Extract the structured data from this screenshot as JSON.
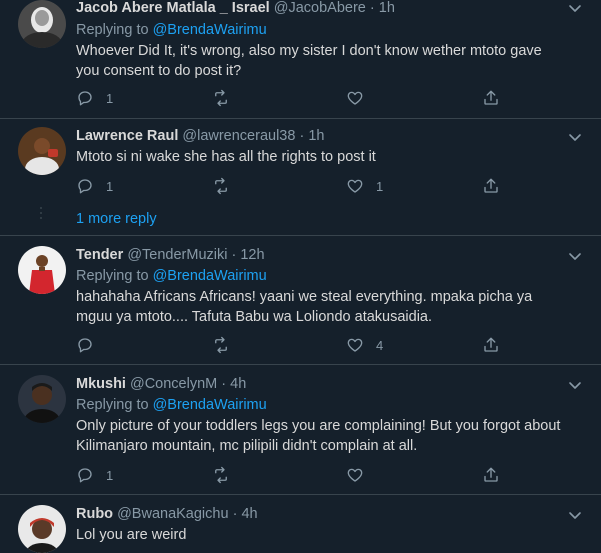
{
  "colors": {
    "background": "#15202b",
    "text": "#d9d9d9",
    "muted": "#8899a6",
    "accent": "#1da1f2",
    "separator": "#38444d"
  },
  "tweets": [
    {
      "name": "Jacob Abere Matlala _ Israel",
      "handle": "@JacobAbere",
      "dot": "·",
      "time": "1h",
      "replying_prefix": "Replying to ",
      "replying_to": "@BrendaWairimu",
      "text_lines": [
        "Whoever Did It, it's wrong, also my sister I don't know wether mtoto gave",
        "you consent to do post it?"
      ],
      "reply_count": "1",
      "retweet_count": "",
      "like_count": "",
      "icons": {
        "reply": "reply-icon",
        "retweet": "retweet-icon",
        "like": "heart-icon",
        "share": "share-icon",
        "menu": "chevron-down-icon"
      }
    },
    {
      "name": "Lawrence Raul",
      "handle": "@lawrenceraul38",
      "dot": "·",
      "time": "1h",
      "text_lines": [
        "Mtoto si ni wake she has all the rights to post it"
      ],
      "reply_count": "1",
      "retweet_count": "",
      "like_count": "1"
    },
    {
      "name": "Tender",
      "handle": "@TenderMuziki",
      "dot": "·",
      "time": "12h",
      "replying_prefix": "Replying to ",
      "replying_to": "@BrendaWairimu",
      "text_lines": [
        "hahahaha Africans Africans! yaani we steal everything. mpaka picha ya",
        "mguu ya mtoto.... Tafuta Babu wa Loliondo atakusaidia."
      ],
      "reply_count": "",
      "retweet_count": "",
      "like_count": "4"
    },
    {
      "name": "Mkushi",
      "handle": "@ConcelynM",
      "dot": "·",
      "time": "4h",
      "replying_prefix": "Replying to ",
      "replying_to": "@BrendaWairimu",
      "text_lines": [
        "Only picture of your toddlers legs you are complaining! But you forgot about",
        "Kilimanjaro mountain, mc pilipili didn't complain at all."
      ],
      "reply_count": "1",
      "retweet_count": "",
      "like_count": ""
    },
    {
      "name": "Rubo",
      "handle": "@BwanaKagichu",
      "dot": "·",
      "time": "4h",
      "text_lines": [
        "Lol you are weird"
      ]
    }
  ],
  "more_replies": "1 more reply"
}
